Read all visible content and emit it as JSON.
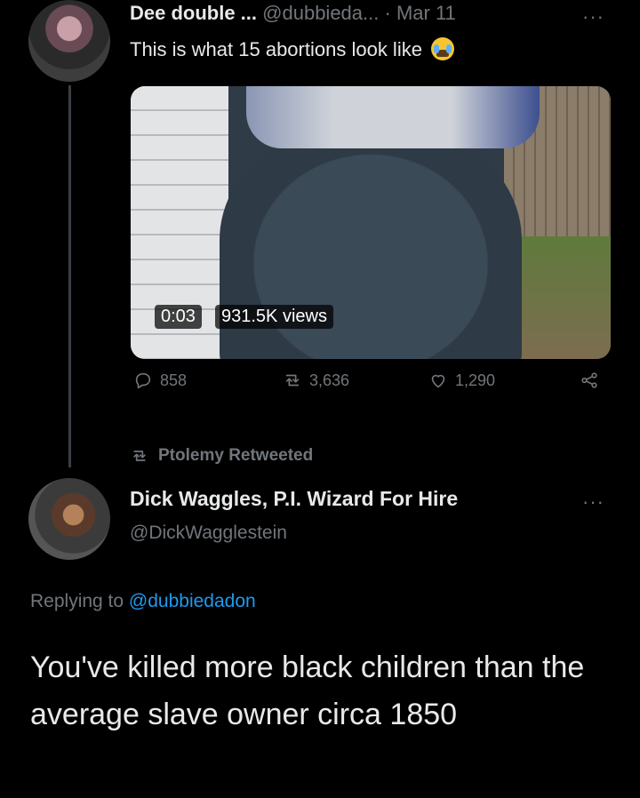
{
  "tweet1": {
    "display_name": "Dee double ...",
    "handle": "@dubbieda...",
    "separator": "·",
    "date": "Mar 11",
    "more": "···",
    "text": "This is what 15 abortions look like",
    "emoji_icon": "loudly-crying-face-icon",
    "video": {
      "timestamp": "0:03",
      "views": "931.5K views"
    },
    "actions": {
      "replies": "858",
      "retweets": "3,636",
      "likes": "1,290"
    }
  },
  "retweet_banner": "Ptolemy Retweeted",
  "tweet2": {
    "display_name": "Dick Waggles, P.I. Wizard For Hire",
    "handle": "@DickWagglestein",
    "more": "···",
    "replying_prefix": "Replying to",
    "replying_to": "@dubbiedadon",
    "text": "You've killed more black children than the average slave owner circa 1850"
  },
  "colors": {
    "background": "#000000",
    "text": "#e7e9ea",
    "muted": "#71767b",
    "link": "#1d9bf0"
  }
}
